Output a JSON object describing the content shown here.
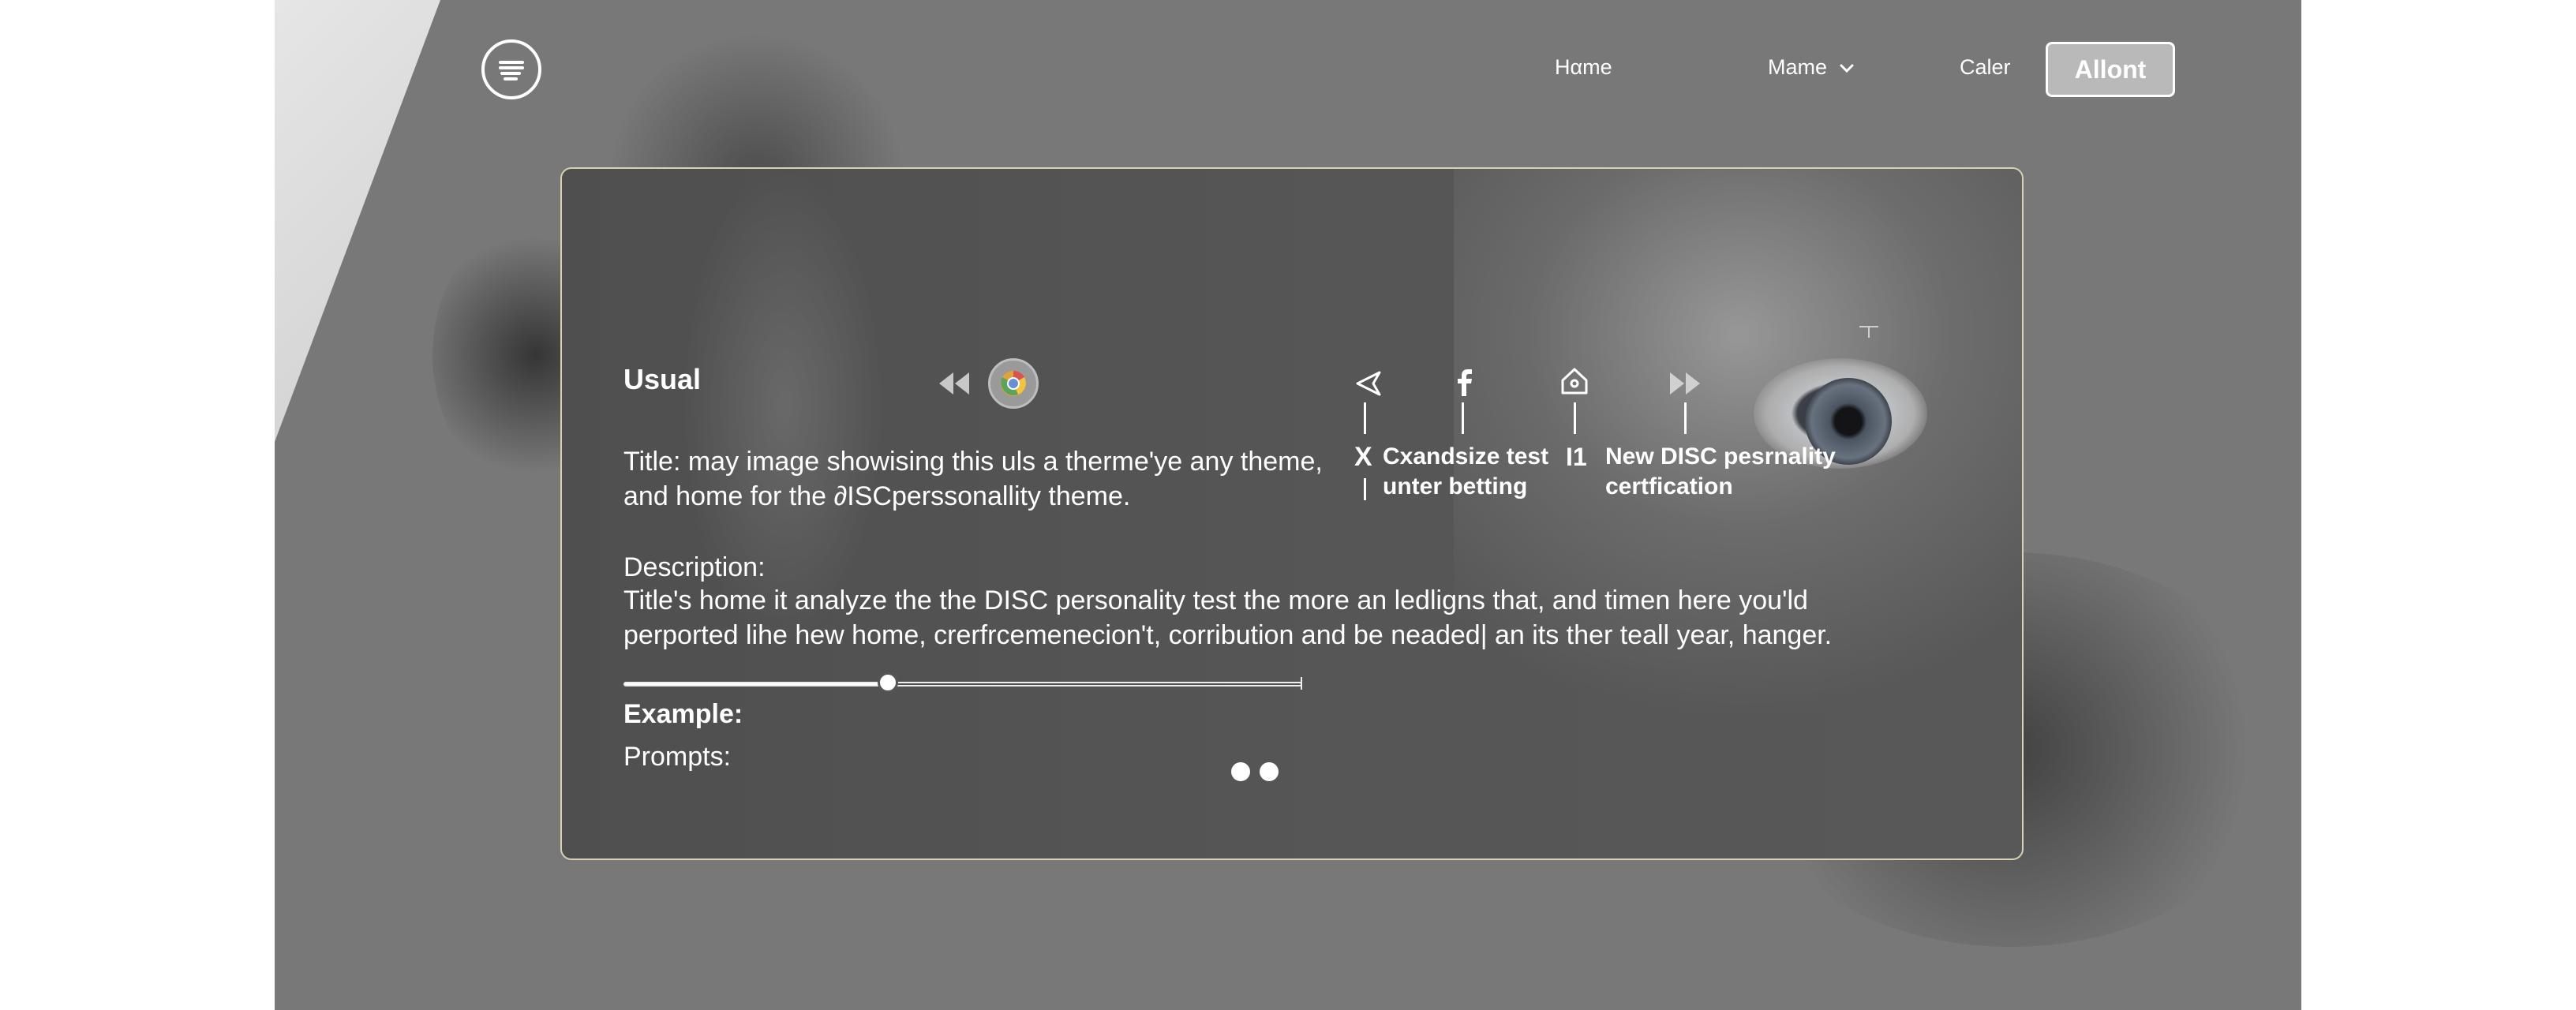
{
  "header": {
    "nav": [
      {
        "label": "Hαme"
      },
      {
        "label": "Mame"
      },
      {
        "label": "Caler"
      }
    ],
    "cta_label": "Allont"
  },
  "card": {
    "heading": "Usual",
    "title_lines": [
      "Title: may image showising this uls a therme'ye any theme,",
      "and home for the ∂ISCperssonallity  theme."
    ],
    "description_label": "Description:",
    "description_lines": [
      "Title's home it analyze the the DISC personality test the more an ledligns that, and timen here you'ld",
      "perported lihe hew home, crerfrcemenecion't, corribution and be neaded| an its ther teall year, hanger."
    ],
    "example_label": "Example:",
    "prompts_label": "Prompts:",
    "slider": {
      "value": 0.39
    },
    "pager": {
      "count": 2,
      "active": 0
    },
    "annotations": {
      "x": "X",
      "cxandsize_lines": [
        "Cxandsize test",
        "unter betting"
      ],
      "eleven": "I1",
      "new_disc_lines": [
        "New DISC pesrnality",
        "certfication"
      ]
    }
  },
  "icons": [
    "list-icon",
    "chevron-down-icon",
    "rewind-icon",
    "browser-icon",
    "back-arrow-icon",
    "facebook-icon",
    "house-icon",
    "fast-forward-icon",
    "plus-icon"
  ],
  "colors": {
    "page_bg": "#787878",
    "card_border": "#d8d2b4",
    "cta_bg": "#b9b9b9"
  }
}
